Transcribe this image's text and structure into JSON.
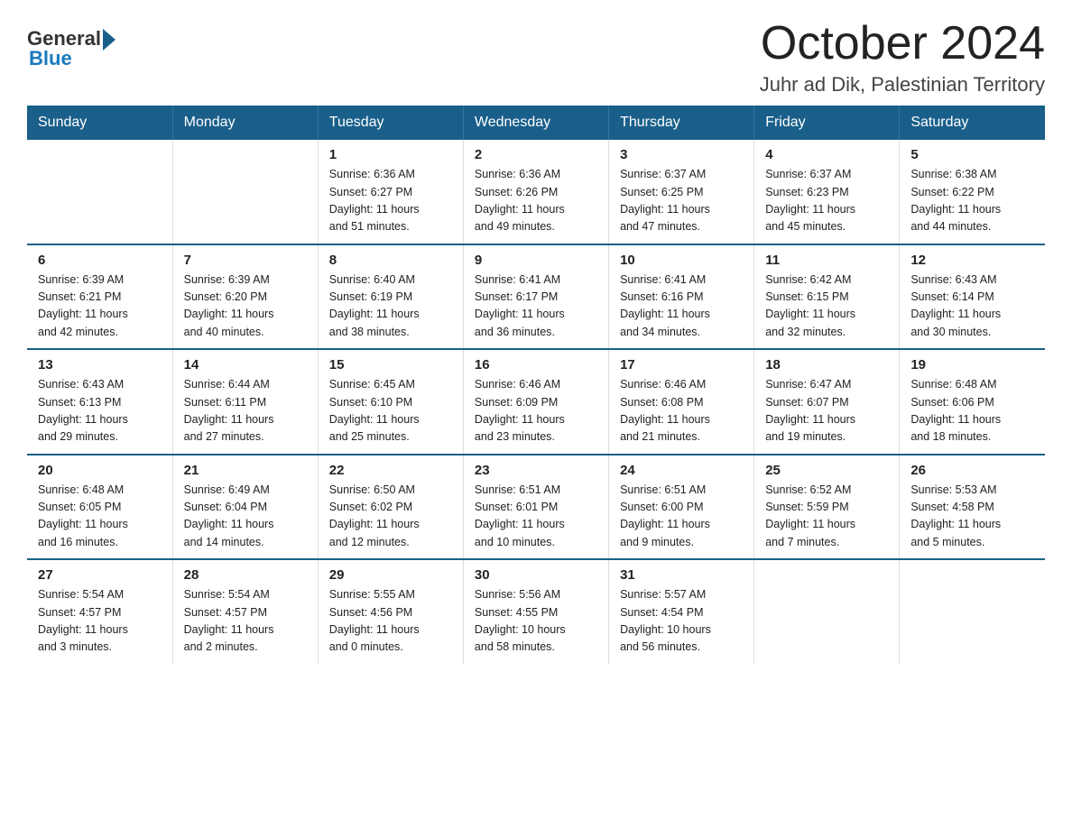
{
  "logo": {
    "general": "General",
    "blue": "Blue"
  },
  "header": {
    "month_year": "October 2024",
    "location": "Juhr ad Dik, Palestinian Territory"
  },
  "columns": [
    "Sunday",
    "Monday",
    "Tuesday",
    "Wednesday",
    "Thursday",
    "Friday",
    "Saturday"
  ],
  "weeks": [
    [
      {
        "day": "",
        "info": ""
      },
      {
        "day": "",
        "info": ""
      },
      {
        "day": "1",
        "info": "Sunrise: 6:36 AM\nSunset: 6:27 PM\nDaylight: 11 hours\nand 51 minutes."
      },
      {
        "day": "2",
        "info": "Sunrise: 6:36 AM\nSunset: 6:26 PM\nDaylight: 11 hours\nand 49 minutes."
      },
      {
        "day": "3",
        "info": "Sunrise: 6:37 AM\nSunset: 6:25 PM\nDaylight: 11 hours\nand 47 minutes."
      },
      {
        "day": "4",
        "info": "Sunrise: 6:37 AM\nSunset: 6:23 PM\nDaylight: 11 hours\nand 45 minutes."
      },
      {
        "day": "5",
        "info": "Sunrise: 6:38 AM\nSunset: 6:22 PM\nDaylight: 11 hours\nand 44 minutes."
      }
    ],
    [
      {
        "day": "6",
        "info": "Sunrise: 6:39 AM\nSunset: 6:21 PM\nDaylight: 11 hours\nand 42 minutes."
      },
      {
        "day": "7",
        "info": "Sunrise: 6:39 AM\nSunset: 6:20 PM\nDaylight: 11 hours\nand 40 minutes."
      },
      {
        "day": "8",
        "info": "Sunrise: 6:40 AM\nSunset: 6:19 PM\nDaylight: 11 hours\nand 38 minutes."
      },
      {
        "day": "9",
        "info": "Sunrise: 6:41 AM\nSunset: 6:17 PM\nDaylight: 11 hours\nand 36 minutes."
      },
      {
        "day": "10",
        "info": "Sunrise: 6:41 AM\nSunset: 6:16 PM\nDaylight: 11 hours\nand 34 minutes."
      },
      {
        "day": "11",
        "info": "Sunrise: 6:42 AM\nSunset: 6:15 PM\nDaylight: 11 hours\nand 32 minutes."
      },
      {
        "day": "12",
        "info": "Sunrise: 6:43 AM\nSunset: 6:14 PM\nDaylight: 11 hours\nand 30 minutes."
      }
    ],
    [
      {
        "day": "13",
        "info": "Sunrise: 6:43 AM\nSunset: 6:13 PM\nDaylight: 11 hours\nand 29 minutes."
      },
      {
        "day": "14",
        "info": "Sunrise: 6:44 AM\nSunset: 6:11 PM\nDaylight: 11 hours\nand 27 minutes."
      },
      {
        "day": "15",
        "info": "Sunrise: 6:45 AM\nSunset: 6:10 PM\nDaylight: 11 hours\nand 25 minutes."
      },
      {
        "day": "16",
        "info": "Sunrise: 6:46 AM\nSunset: 6:09 PM\nDaylight: 11 hours\nand 23 minutes."
      },
      {
        "day": "17",
        "info": "Sunrise: 6:46 AM\nSunset: 6:08 PM\nDaylight: 11 hours\nand 21 minutes."
      },
      {
        "day": "18",
        "info": "Sunrise: 6:47 AM\nSunset: 6:07 PM\nDaylight: 11 hours\nand 19 minutes."
      },
      {
        "day": "19",
        "info": "Sunrise: 6:48 AM\nSunset: 6:06 PM\nDaylight: 11 hours\nand 18 minutes."
      }
    ],
    [
      {
        "day": "20",
        "info": "Sunrise: 6:48 AM\nSunset: 6:05 PM\nDaylight: 11 hours\nand 16 minutes."
      },
      {
        "day": "21",
        "info": "Sunrise: 6:49 AM\nSunset: 6:04 PM\nDaylight: 11 hours\nand 14 minutes."
      },
      {
        "day": "22",
        "info": "Sunrise: 6:50 AM\nSunset: 6:02 PM\nDaylight: 11 hours\nand 12 minutes."
      },
      {
        "day": "23",
        "info": "Sunrise: 6:51 AM\nSunset: 6:01 PM\nDaylight: 11 hours\nand 10 minutes."
      },
      {
        "day": "24",
        "info": "Sunrise: 6:51 AM\nSunset: 6:00 PM\nDaylight: 11 hours\nand 9 minutes."
      },
      {
        "day": "25",
        "info": "Sunrise: 6:52 AM\nSunset: 5:59 PM\nDaylight: 11 hours\nand 7 minutes."
      },
      {
        "day": "26",
        "info": "Sunrise: 5:53 AM\nSunset: 4:58 PM\nDaylight: 11 hours\nand 5 minutes."
      }
    ],
    [
      {
        "day": "27",
        "info": "Sunrise: 5:54 AM\nSunset: 4:57 PM\nDaylight: 11 hours\nand 3 minutes."
      },
      {
        "day": "28",
        "info": "Sunrise: 5:54 AM\nSunset: 4:57 PM\nDaylight: 11 hours\nand 2 minutes."
      },
      {
        "day": "29",
        "info": "Sunrise: 5:55 AM\nSunset: 4:56 PM\nDaylight: 11 hours\nand 0 minutes."
      },
      {
        "day": "30",
        "info": "Sunrise: 5:56 AM\nSunset: 4:55 PM\nDaylight: 10 hours\nand 58 minutes."
      },
      {
        "day": "31",
        "info": "Sunrise: 5:57 AM\nSunset: 4:54 PM\nDaylight: 10 hours\nand 56 minutes."
      },
      {
        "day": "",
        "info": ""
      },
      {
        "day": "",
        "info": ""
      }
    ]
  ]
}
